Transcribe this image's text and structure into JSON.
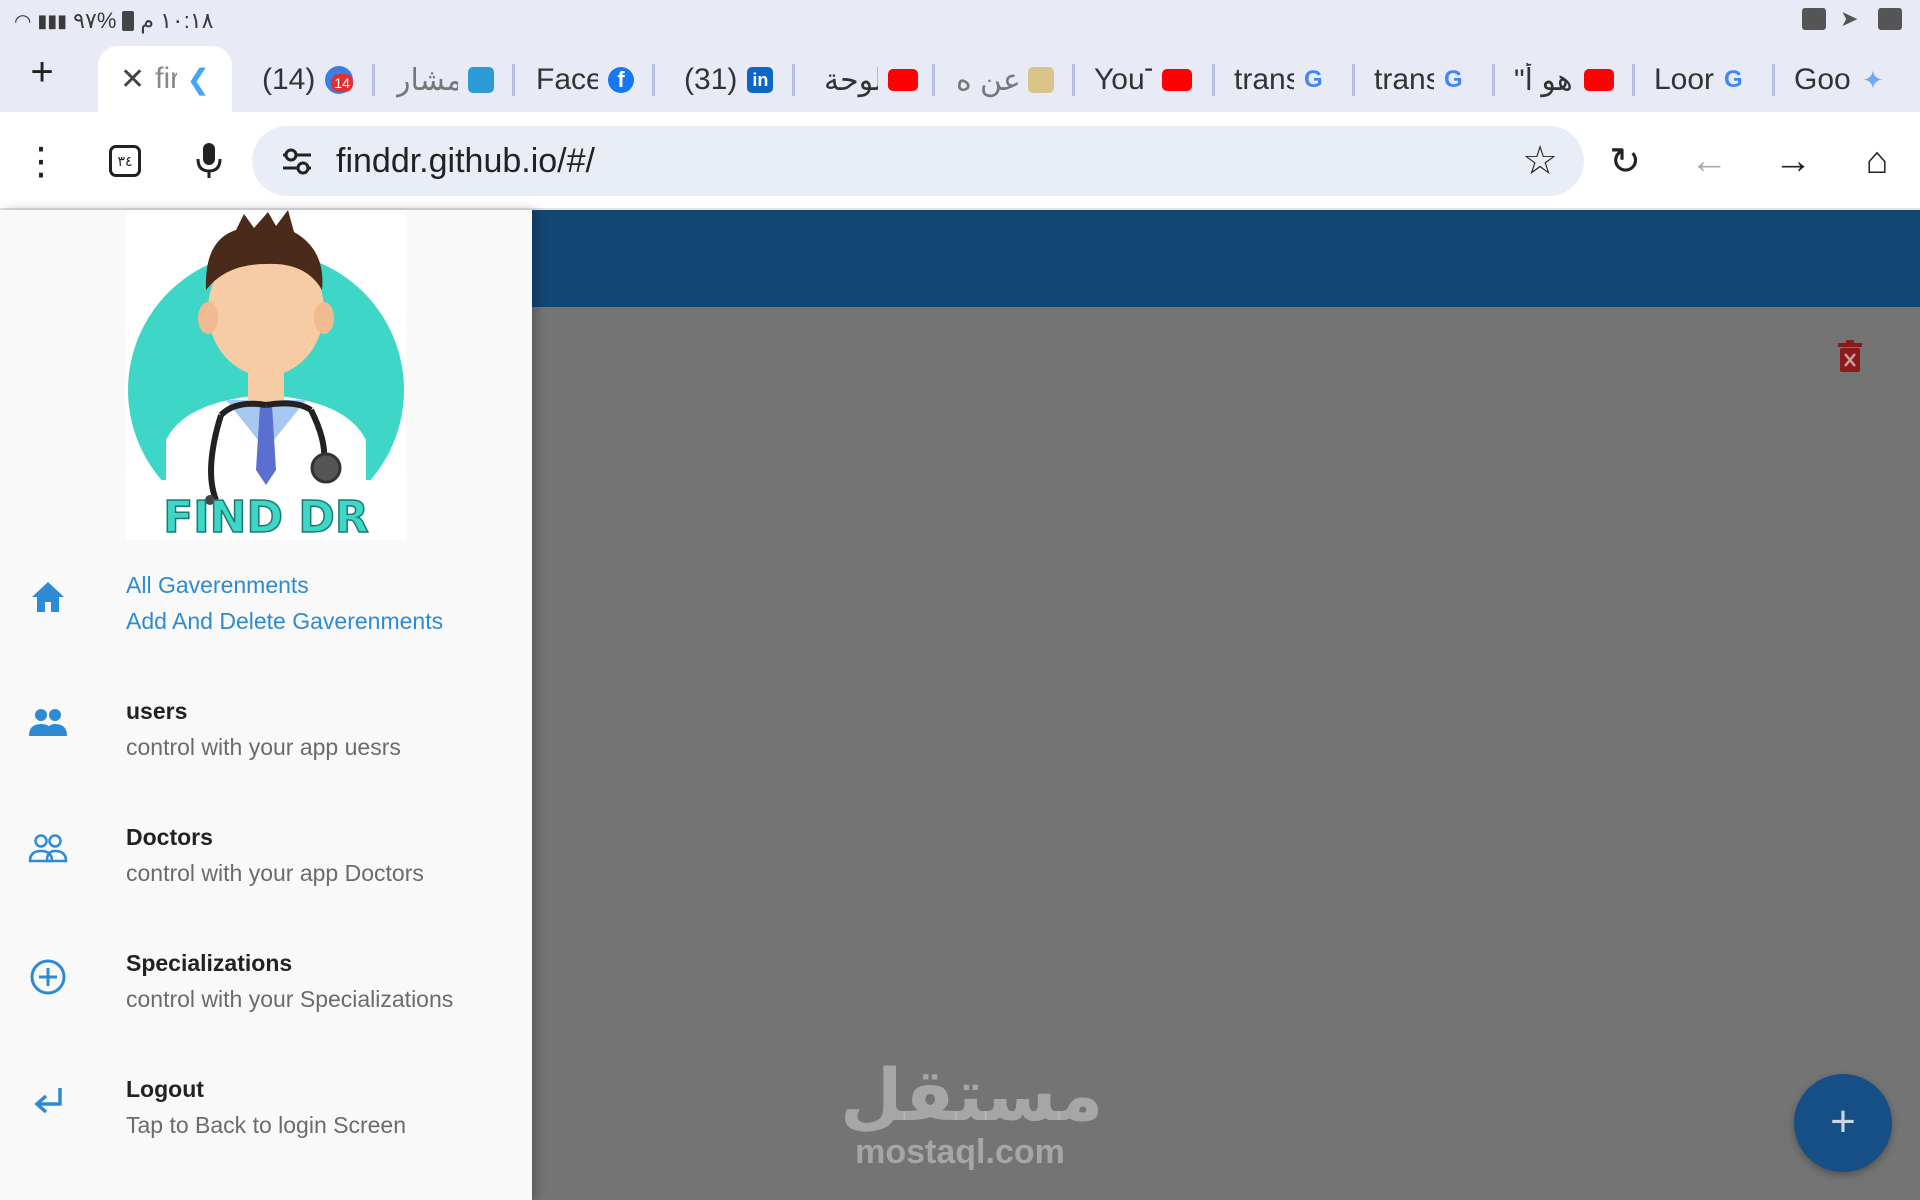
{
  "status_bar": {
    "time": "١٠:١٨ م",
    "battery": "%٩٧"
  },
  "tabs": [
    {
      "title": "fir",
      "icon": "flutter-icon",
      "active": true
    },
    {
      "title": "(14)",
      "icon": "messenger-icon",
      "badge": "14"
    },
    {
      "title": "المشار",
      "icon": "app-icon"
    },
    {
      "title": "Face",
      "icon": "facebook-icon"
    },
    {
      "title": "(31)",
      "icon": "linkedin-icon"
    },
    {
      "title": "لوحة",
      "icon": "youtube-icon"
    },
    {
      "title": "عن ه",
      "icon": "site-icon"
    },
    {
      "title": "YouT",
      "icon": "youtube-icon"
    },
    {
      "title": "trans",
      "icon": "google-icon"
    },
    {
      "title": "trans",
      "icon": "google-icon"
    },
    {
      "title": "\"هو أ",
      "icon": "youtube-icon"
    },
    {
      "title": "Loor",
      "icon": "google-icon"
    },
    {
      "title": "Goo",
      "icon": "gemini-icon"
    }
  ],
  "toolbar": {
    "url": "finddr.github.io/#/",
    "tab_count": "٣٤"
  },
  "logo": {
    "text": "FIND DR"
  },
  "drawer": {
    "items": [
      {
        "title": "All Gaverenments",
        "subtitle": "Add And Delete Gaverenments",
        "icon": "home-icon",
        "selected": true
      },
      {
        "title": "users",
        "subtitle": "control with your app uesrs",
        "icon": "people-icon"
      },
      {
        "title": "Doctors",
        "subtitle": "control with your app Doctors",
        "icon": "people-outline-icon"
      },
      {
        "title": "Specializations",
        "subtitle": "control with your Specializations",
        "icon": "add-circle-icon"
      },
      {
        "title": "Logout",
        "subtitle": "Tap to Back to login Screen",
        "icon": "return-icon"
      }
    ]
  },
  "watermark": {
    "arabic": "مستقل",
    "english": "mostaql.com"
  },
  "colors": {
    "appbar": "#124673",
    "accent": "#2d8ad4",
    "fab": "#154f85",
    "delete": "#8b1b1b"
  }
}
